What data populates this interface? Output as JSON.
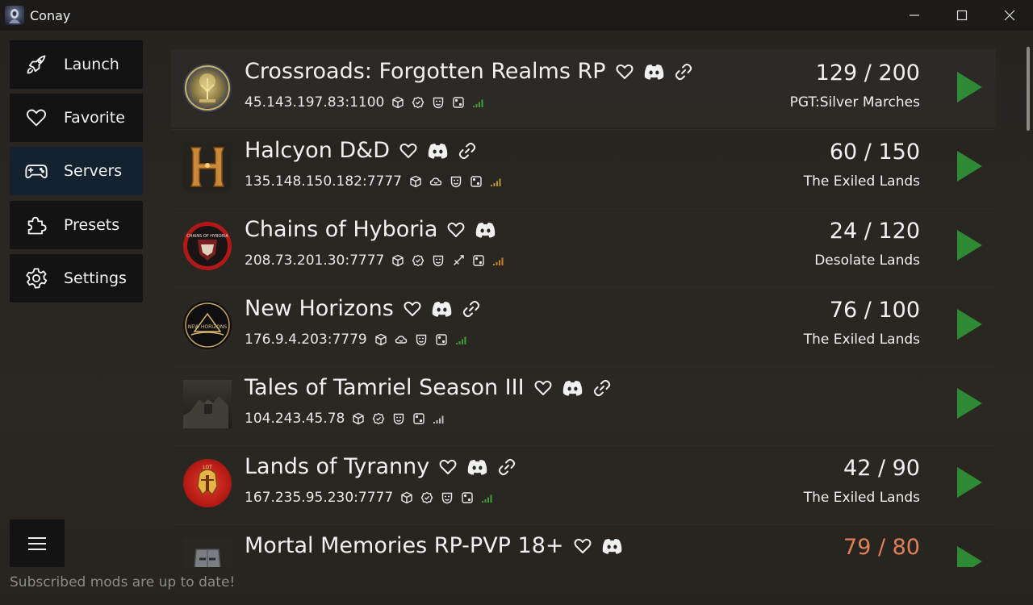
{
  "app": {
    "title": "Conay"
  },
  "window_controls": {
    "minimize": "minimize-icon",
    "maximize": "maximize-icon",
    "close": "close-icon"
  },
  "sidebar": {
    "items": [
      {
        "label": "Launch",
        "icon": "rocket-icon",
        "active": false
      },
      {
        "label": "Favorite",
        "icon": "heart-icon",
        "active": false
      },
      {
        "label": "Servers",
        "icon": "gamepad-icon",
        "active": true
      },
      {
        "label": "Presets",
        "icon": "puzzle-icon",
        "active": false
      },
      {
        "label": "Settings",
        "icon": "gear-icon",
        "active": false
      }
    ],
    "menu_icon": "hamburger-menu-icon"
  },
  "status": {
    "message": "Subscribed mods are up to date!"
  },
  "colors": {
    "play": "#2e8a35",
    "active_nav": "#14222f",
    "signal_green": "#3fa03a",
    "signal_yellow": "#b29b2c",
    "full_players": "#e0805a"
  },
  "servers": [
    {
      "name": "Crossroads: Forgotten Realms RP",
      "address": "45.143.197.83:1100",
      "players": "129 / 200",
      "map": "PGT:Silver Marches",
      "discord": true,
      "link": true,
      "extra_mod": false,
      "signal": "green"
    },
    {
      "name": "Halcyon D&D",
      "address": "135.148.150.182:7777",
      "players": "60 / 150",
      "map": "The Exiled Lands",
      "discord": true,
      "link": true,
      "extra_mod": false,
      "signal": "yellow"
    },
    {
      "name": "Chains of Hyboria",
      "address": "208.73.201.30:7777",
      "players": "24 / 120",
      "map": "Desolate Lands",
      "discord": true,
      "link": false,
      "extra_mod": true,
      "signal": "orange"
    },
    {
      "name": "New Horizons",
      "address": "176.9.4.203:7779",
      "players": "76 / 100",
      "map": "The Exiled Lands",
      "discord": true,
      "link": true,
      "extra_mod": false,
      "signal": "green"
    },
    {
      "name": "Tales of Tamriel Season III",
      "address": "104.243.45.78",
      "players": "",
      "map": "",
      "discord": true,
      "link": true,
      "extra_mod": false,
      "signal": "grey"
    },
    {
      "name": "Lands of Tyranny",
      "address": "167.235.95.230:7777",
      "players": "42 / 90",
      "map": "The Exiled Lands",
      "discord": true,
      "link": true,
      "extra_mod": false,
      "signal": "green"
    },
    {
      "name": "Mortal Memories RP-PVP 18+",
      "address": "",
      "players": "79 / 80",
      "map": "",
      "discord": true,
      "link": false,
      "extra_mod": false,
      "signal": "none"
    }
  ]
}
